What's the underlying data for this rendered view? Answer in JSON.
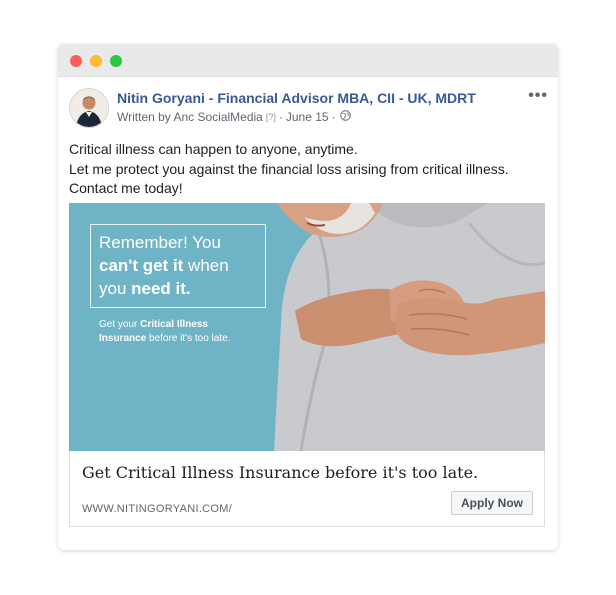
{
  "post": {
    "author": "Nitin Goryani - Financial Advisor MBA, CII - UK, MDRT",
    "written_by": "Written by Anc SocialMedia",
    "help_mark": "[?]",
    "date": "June 15",
    "more_icon": "more-options-icon",
    "text_lines": [
      "Critical illness can happen to anyone, anytime.",
      "Let me protect you against the financial loss arising from critical illness.",
      "Contact me today!"
    ]
  },
  "ad": {
    "headline_1": "Remember! You",
    "headline_2_bold": "can't get it",
    "headline_2_rest": " when",
    "headline_3_start": "you ",
    "headline_3_bold": "need it.",
    "sub_1": "Get your ",
    "sub_1_bold": "Critical Illness",
    "sub_2_bold": "Insurance",
    "sub_2_rest": " before it's too late.",
    "background_color": "#6fb4c6"
  },
  "link": {
    "title": "Get Critical Illness Insurance before it's too late.",
    "domain": "WWW.NITINGORYANI.COM/",
    "cta": "Apply Now"
  }
}
